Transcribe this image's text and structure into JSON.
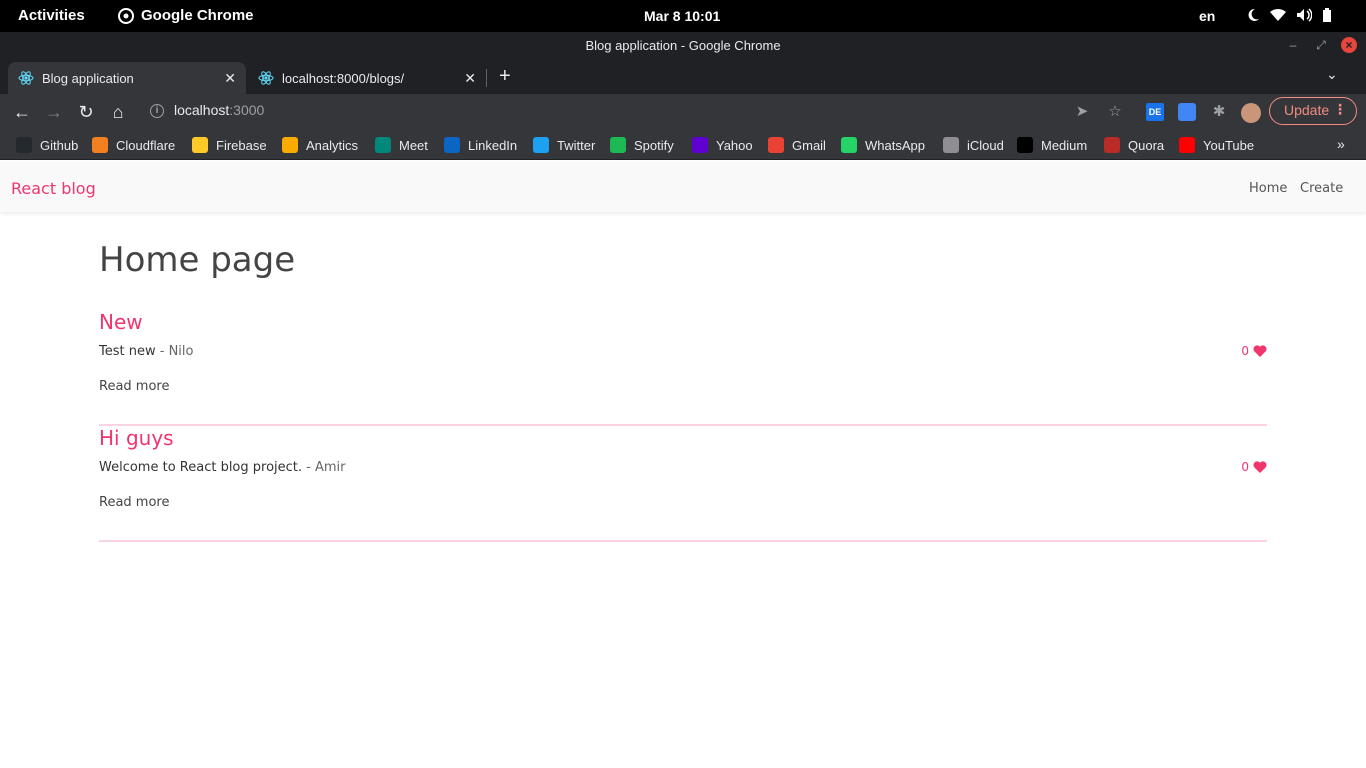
{
  "os_bar": {
    "activities": "Activities",
    "app_name": "Google Chrome",
    "clock": "Mar 8  10:01",
    "lang": "en"
  },
  "window": {
    "title": "Blog application - Google Chrome"
  },
  "tabs": [
    {
      "label": "Blog application",
      "active": true
    },
    {
      "label": "localhost:8000/blogs/",
      "active": false
    }
  ],
  "omnibox": {
    "host": "localhost",
    "port": ":3000"
  },
  "toolbar": {
    "update_label": "Update"
  },
  "bookmarks": [
    {
      "label": "Github",
      "icon": "github-icon",
      "color": "#24292e"
    },
    {
      "label": "Cloudflare",
      "icon": "cloudflare-icon",
      "color": "#f38020"
    },
    {
      "label": "Firebase",
      "icon": "firebase-icon",
      "color": "#ffca28"
    },
    {
      "label": "Analytics",
      "icon": "analytics-icon",
      "color": "#f9ab00"
    },
    {
      "label": "Meet",
      "icon": "meet-icon",
      "color": "#00897b"
    },
    {
      "label": "LinkedIn",
      "icon": "linkedin-icon",
      "color": "#0a66c2"
    },
    {
      "label": "Twitter",
      "icon": "twitter-icon",
      "color": "#1da1f2"
    },
    {
      "label": "Spotify",
      "icon": "spotify-icon",
      "color": "#1db954"
    },
    {
      "label": "Yahoo",
      "icon": "yahoo-icon",
      "color": "#6001d2"
    },
    {
      "label": "Gmail",
      "icon": "gmail-icon",
      "color": "#ea4335"
    },
    {
      "label": "WhatsApp",
      "icon": "whatsapp-icon",
      "color": "#25d366"
    },
    {
      "label": "iCloud",
      "icon": "apple-icon",
      "color": "#8e8e93"
    },
    {
      "label": "Medium",
      "icon": "medium-icon",
      "color": "#000000"
    },
    {
      "label": "Quora",
      "icon": "quora-icon",
      "color": "#b92b27"
    },
    {
      "label": "YouTube",
      "icon": "youtube-icon",
      "color": "#ff0000"
    }
  ],
  "site": {
    "brand": "React blog",
    "nav": {
      "home": "Home",
      "create": "Create"
    },
    "heading": "Home page",
    "read_more": "Read more",
    "accent": "#f1356d",
    "posts": [
      {
        "title": "New",
        "body": "Test new",
        "author": "- Nilo",
        "likes": "0"
      },
      {
        "title": "Hi guys",
        "body": "Welcome to React blog project.",
        "author": "- Amir",
        "likes": "0"
      }
    ]
  }
}
